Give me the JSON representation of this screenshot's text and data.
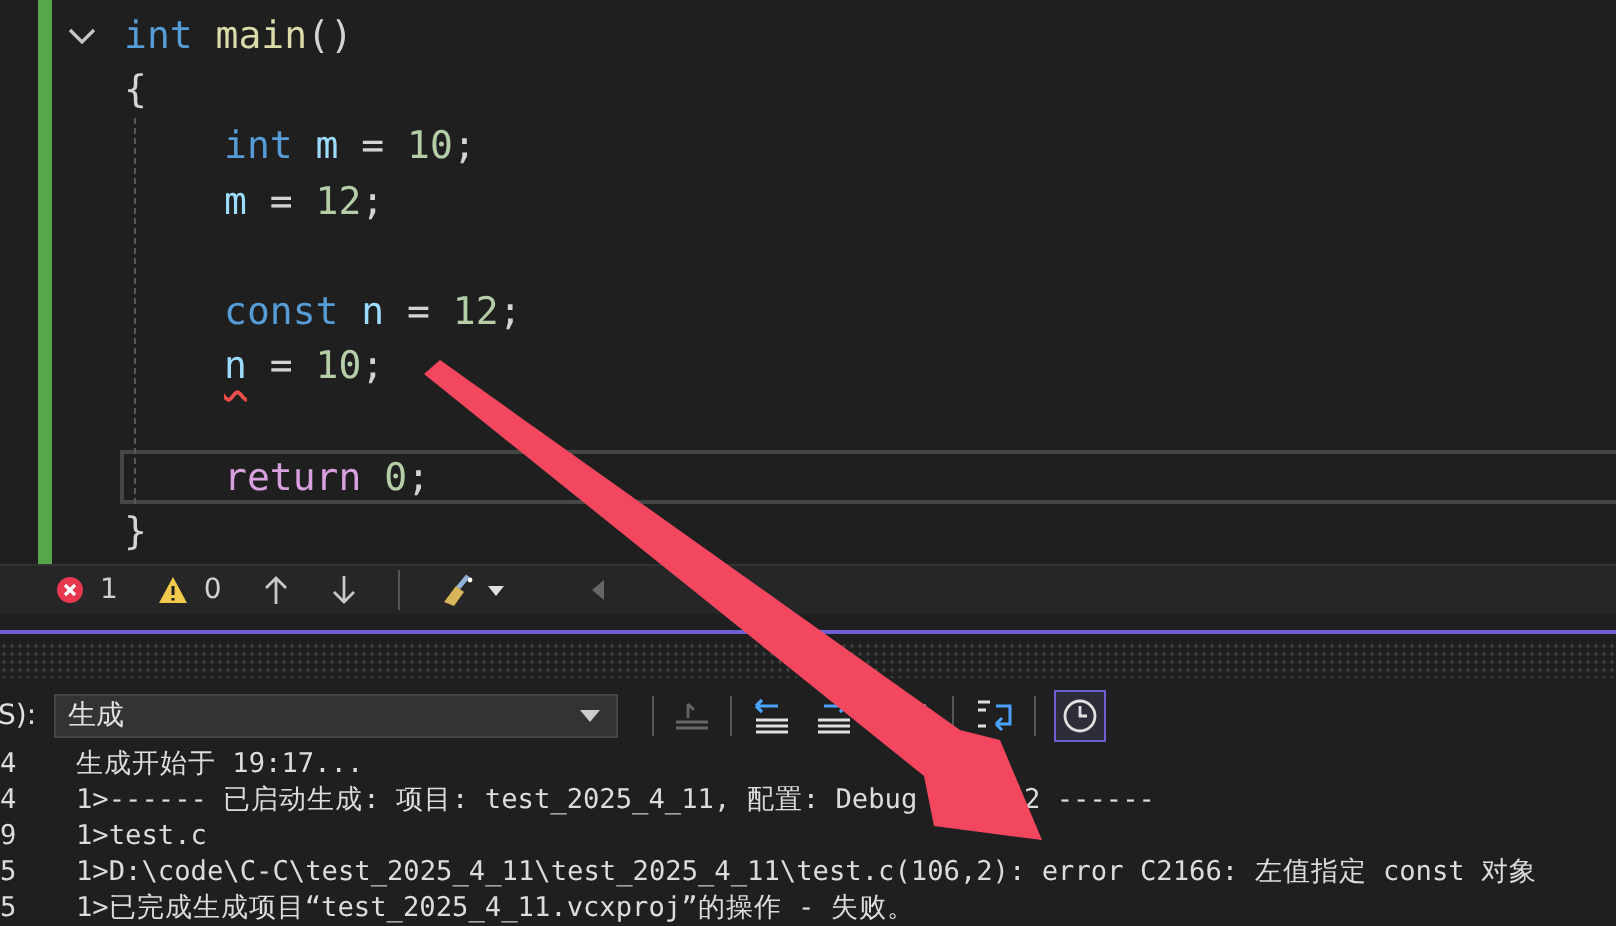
{
  "editor": {
    "function_line": {
      "expanded": true,
      "tokens": [
        {
          "text": "int ",
          "kind": "keyword"
        },
        {
          "text": "main",
          "kind": "func"
        },
        {
          "text": "()",
          "kind": "punct"
        }
      ]
    },
    "open_brace": "{",
    "body": [
      {
        "kind": "code",
        "current": false,
        "tokens": [
          {
            "text": "int ",
            "kind": "keyword"
          },
          {
            "text": "m",
            "kind": "var"
          },
          {
            "text": " = ",
            "kind": "punct"
          },
          {
            "text": "10",
            "kind": "num"
          },
          {
            "text": ";",
            "kind": "punct"
          }
        ]
      },
      {
        "kind": "code",
        "current": false,
        "tokens": [
          {
            "text": "m",
            "kind": "var"
          },
          {
            "text": " = ",
            "kind": "punct"
          },
          {
            "text": "12",
            "kind": "num"
          },
          {
            "text": ";",
            "kind": "punct"
          }
        ]
      },
      {
        "kind": "blank",
        "current": false
      },
      {
        "kind": "code",
        "current": false,
        "tokens": [
          {
            "text": "const ",
            "kind": "keyword"
          },
          {
            "text": "n",
            "kind": "var"
          },
          {
            "text": " = ",
            "kind": "punct"
          },
          {
            "text": "12",
            "kind": "num"
          },
          {
            "text": ";",
            "kind": "punct"
          }
        ]
      },
      {
        "kind": "code",
        "current": false,
        "tokens": [
          {
            "text": "n",
            "kind": "var",
            "error": true
          },
          {
            "text": " = ",
            "kind": "punct"
          },
          {
            "text": "10",
            "kind": "num"
          },
          {
            "text": ";",
            "kind": "punct"
          }
        ]
      },
      {
        "kind": "blank",
        "current": false
      },
      {
        "kind": "code",
        "current": true,
        "tokens": [
          {
            "text": "return ",
            "kind": "control"
          },
          {
            "text": "0",
            "kind": "num"
          },
          {
            "text": ";",
            "kind": "punct"
          }
        ]
      }
    ],
    "close_brace": "}"
  },
  "error_bar": {
    "errors": "1",
    "warnings": "0"
  },
  "output": {
    "source_label": "S):",
    "source": "生成",
    "lines": [
      {
        "line_number": "4",
        "segments": [
          "生成开始于 19:17..."
        ]
      },
      {
        "line_number": "4",
        "segments": [
          "1>------ 已启动生成: 项目: test_2025_4_11, 配置: Debug",
          "2 ------"
        ]
      },
      {
        "line_number": "9",
        "segments": [
          "1>test.c"
        ]
      },
      {
        "line_number": "5",
        "segments": [
          "1>D:\\code\\C-C\\test_2025_4_11\\test_2025_4_11\\test.c(106,2): error C2166: 左值指定 const 对象"
        ]
      },
      {
        "line_number": "5",
        "segments": [
          "1>已完成生成项目“test_2025_4_11.vcxproj”的操作 - 失败。"
        ]
      }
    ]
  }
}
